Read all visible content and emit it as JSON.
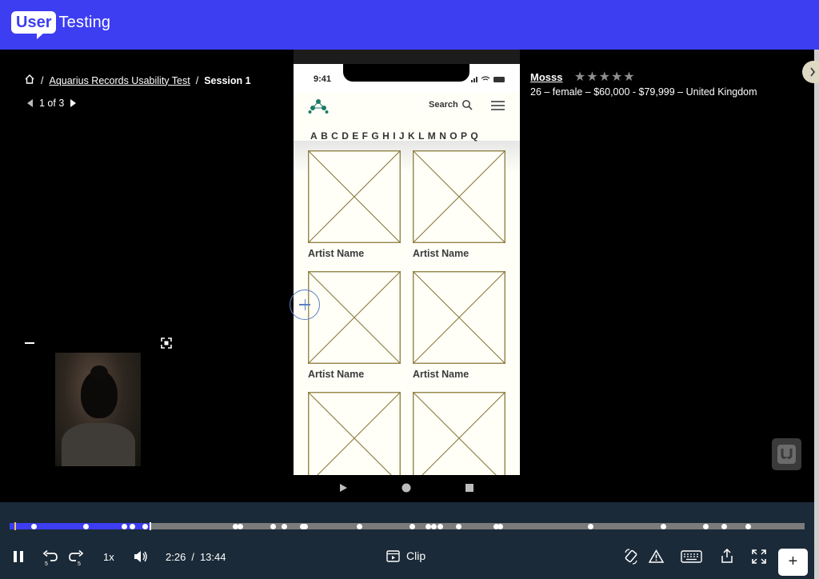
{
  "brand": {
    "logo_box": "User",
    "logo_text": "Testing"
  },
  "breadcrumb": {
    "home_icon": "home-icon",
    "sep": "/",
    "study": "Aquarius Records Usability Test",
    "session": "Session 1"
  },
  "pager": {
    "label": "1 of 3"
  },
  "tester": {
    "name": "Mosss",
    "stars": "★★★★★",
    "rating": 5,
    "meta": "26 – female – $60,000 - $79,999 – United Kingdom"
  },
  "phone": {
    "time": "9:41",
    "search_label": "Search",
    "alphabet": "ABCDEFGHIJKLMNOPQ",
    "artists": [
      {
        "label": "Artist Name"
      },
      {
        "label": "Artist Name"
      },
      {
        "label": "Artist Name"
      },
      {
        "label": "Artist Name"
      },
      {
        "label": ""
      },
      {
        "label": ""
      }
    ]
  },
  "player": {
    "current_time": "2:26",
    "time_sep": "/",
    "duration": "13:44",
    "speed": "1x",
    "clip_label": "Clip",
    "add_label": "+",
    "progress_fraction": 0.177
  },
  "colors": {
    "brand_blue": "#3d3df2",
    "controls_bg": "#1b2a38",
    "wire": "#8a7a3a"
  }
}
